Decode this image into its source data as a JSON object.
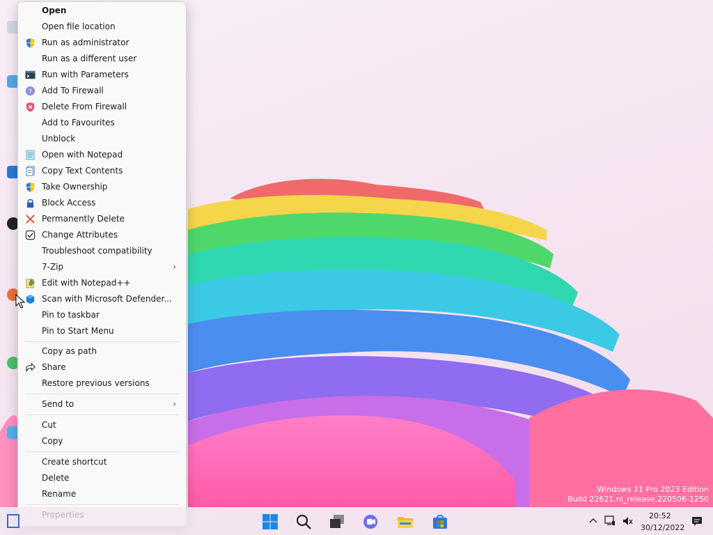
{
  "context_menu": {
    "items": [
      {
        "label": "Open",
        "icon": "none",
        "bold": true
      },
      {
        "label": "Open file location",
        "icon": "none"
      },
      {
        "label": "Run as administrator",
        "icon": "shield-icon"
      },
      {
        "label": "Run as a different user",
        "icon": "none"
      },
      {
        "label": "Run with Parameters",
        "icon": "terminal-icon"
      },
      {
        "label": "Add To Firewall",
        "icon": "help-circle-icon"
      },
      {
        "label": "Delete From Firewall",
        "icon": "shield-x-icon"
      },
      {
        "label": "Add to Favourites",
        "icon": "none"
      },
      {
        "label": "Unblock",
        "icon": "none"
      },
      {
        "label": "Open with Notepad",
        "icon": "notepad-icon"
      },
      {
        "label": "Copy Text Contents",
        "icon": "copy-text-icon"
      },
      {
        "label": "Take Ownership",
        "icon": "shield-icon"
      },
      {
        "label": "Block Access",
        "icon": "lock-icon"
      },
      {
        "label": "Permanently Delete",
        "icon": "red-x-icon"
      },
      {
        "label": "Change Attributes",
        "icon": "checkbox-icon"
      },
      {
        "label": "Troubleshoot compatibility",
        "icon": "none"
      },
      {
        "label": "7-Zip",
        "icon": "none",
        "submenu": true
      },
      {
        "label": "Edit with Notepad++",
        "icon": "notepadpp-icon"
      },
      {
        "label": "Scan with Microsoft Defender...",
        "icon": "defender-icon"
      },
      {
        "label": "Pin to taskbar",
        "icon": "none"
      },
      {
        "label": "Pin to Start Menu",
        "icon": "none"
      },
      {
        "label": "Copy as path",
        "icon": "none"
      },
      {
        "label": "Share",
        "icon": "share-icon"
      },
      {
        "label": "Restore previous versions",
        "icon": "none"
      },
      {
        "label": "Send to",
        "icon": "none",
        "submenu": true
      },
      {
        "label": "Cut",
        "icon": "none"
      },
      {
        "label": "Copy",
        "icon": "none"
      },
      {
        "label": "Create shortcut",
        "icon": "none"
      },
      {
        "label": "Delete",
        "icon": "none"
      },
      {
        "label": "Rename",
        "icon": "none"
      },
      {
        "label": "Properties",
        "icon": "none"
      }
    ]
  },
  "watermark": {
    "line1": "Windows 11 Pro 2023 Edition",
    "line2": "Build 22621.ni_release.220506-1250"
  },
  "taskbar": {
    "icons": [
      "windows-start-icon",
      "search-icon",
      "task-view-icon",
      "teams-chat-icon",
      "file-explorer-icon",
      "store-icon"
    ],
    "tray": {
      "time": "20:52",
      "date": "30/12/2022"
    }
  },
  "colors": {
    "menu_bg": "#f9f9f9",
    "accent_blue": "#0067c0"
  }
}
